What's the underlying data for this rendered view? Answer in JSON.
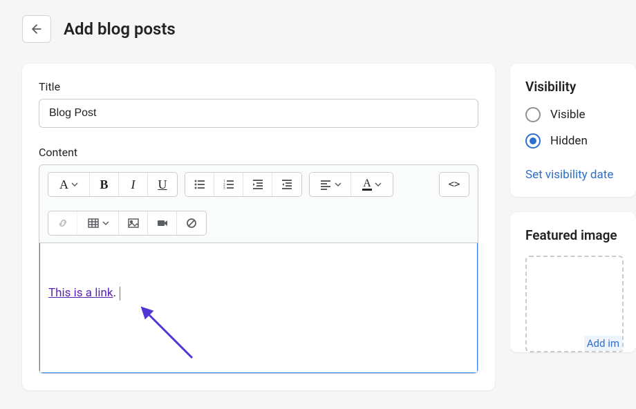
{
  "header": {
    "title": "Add blog posts"
  },
  "main": {
    "title_label": "Title",
    "title_value": "Blog Post",
    "content_label": "Content",
    "editor": {
      "link_text": "This is a link",
      "trailing": ".",
      "code_toggle": "<>"
    }
  },
  "sidebar": {
    "visibility": {
      "title": "Visibility",
      "options": [
        {
          "label": "Visible",
          "checked": false
        },
        {
          "label": "Hidden",
          "checked": true
        }
      ],
      "set_date": "Set visibility date"
    },
    "featured": {
      "title": "Featured image",
      "add_label": "Add im"
    }
  }
}
